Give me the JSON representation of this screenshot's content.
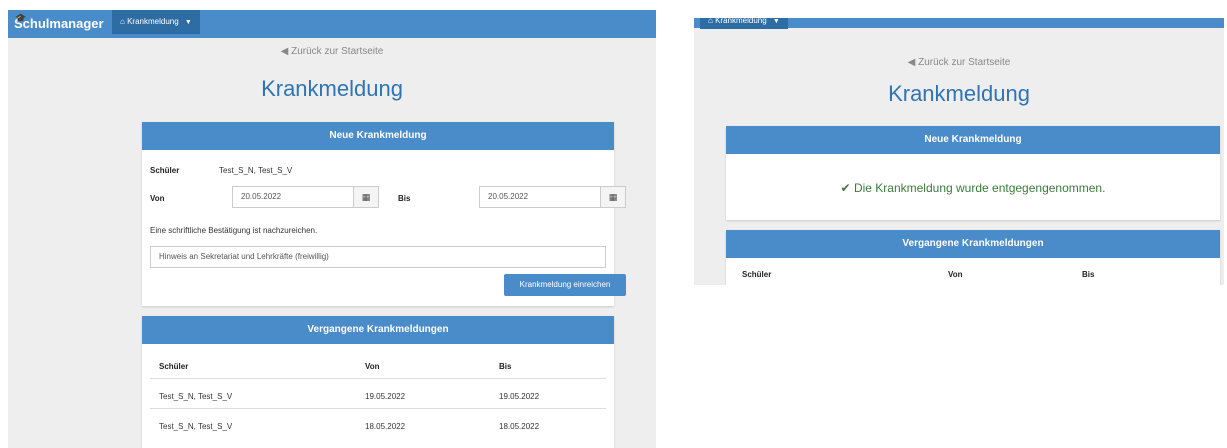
{
  "brand": "Schulmanager",
  "nav_menu": "Krankmeldung",
  "back_link": "Zurück zur Startseite",
  "page_title": "Krankmeldung",
  "form": {
    "header": "Neue Krankmeldung",
    "student_label": "Schüler",
    "student_value": "Test_S_N, Test_S_V",
    "from_label": "Von",
    "from_value": "20.05.2022",
    "to_label": "Bis",
    "to_value": "20.05.2022",
    "note": "Eine schriftliche Bestätigung ist nachzureichen.",
    "hint_placeholder": "Hinweis an Sekretariat und Lehrkräfte (freiwillig)",
    "submit": "Krankmeldung einreichen"
  },
  "past": {
    "header": "Vergangene Krankmeldungen",
    "columns": [
      "Schüler",
      "Von",
      "Bis"
    ],
    "rows": [
      [
        "Test_S_N, Test_S_V",
        "19.05.2022",
        "19.05.2022"
      ],
      [
        "Test_S_N, Test_S_V",
        "18.05.2022",
        "18.05.2022"
      ]
    ]
  },
  "confirmation": "Die Krankmeldung wurde entgegengenommen.",
  "icons": {
    "home": "home-icon",
    "back": "arrow-circle-left-icon",
    "calendar": "calendar-icon",
    "check": "check-icon"
  },
  "colors": {
    "accent": "#4a8bc9",
    "title": "#2f74b5",
    "success": "#3c7a3c"
  }
}
